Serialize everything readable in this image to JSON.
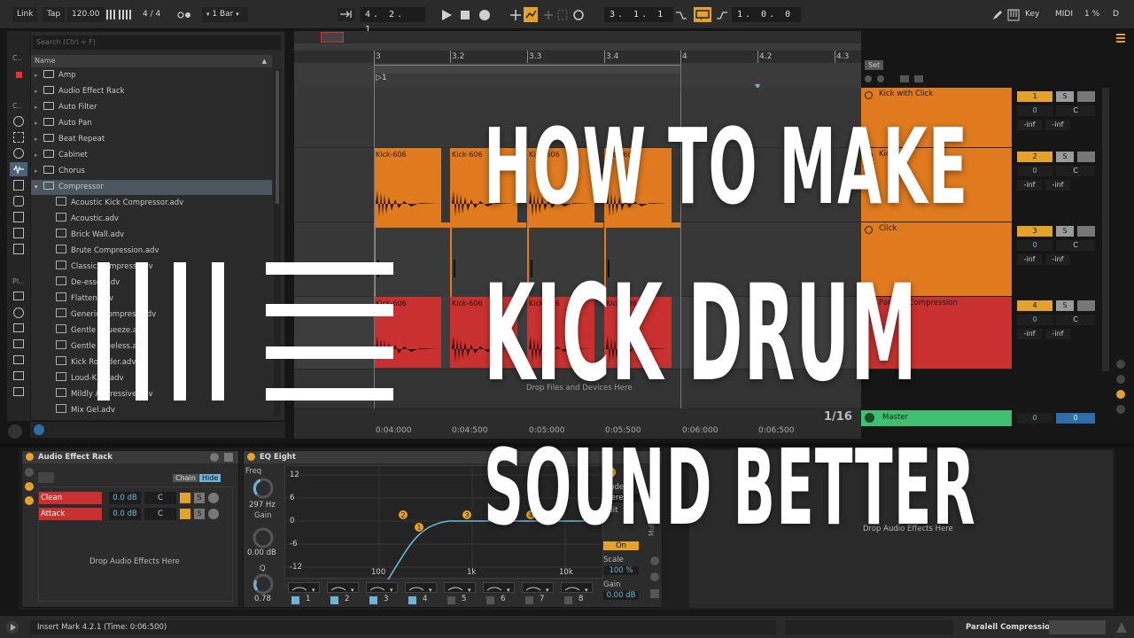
{
  "transport": {
    "link": "Link",
    "tap": "Tap",
    "tempo": "120.00",
    "signature_num": "4",
    "signature_sep": "/",
    "signature_den": "4",
    "quantize": "1 Bar",
    "position": "4. 2. 1",
    "loop_start": "3. 1. 1",
    "loop_length": "1. 0. 0",
    "key": "Key",
    "midi": "MIDI",
    "cpu": "1 %",
    "d": "D"
  },
  "browser": {
    "search_placeholder": "Search (Ctrl + F)",
    "column_name": "Name",
    "folders": [
      "Amp",
      "Audio Effect Rack",
      "Auto Filter",
      "Auto Pan",
      "Beat Repeat",
      "Cabinet",
      "Chorus"
    ],
    "selected_folder": "Compressor",
    "files": [
      "Acoustic Kick Compressor.adv",
      "Acoustic.adv",
      "Brick Wall.adv",
      "Brute Compression.adv",
      "Classic Compress.adv",
      "De-esser.adv",
      "Flatten.adv",
      "Generic Compress.adv",
      "Gentle Squeeze.adv",
      "Gentle Glueless.adv",
      "Kick Rounder.adv",
      "Loud-Kick.adv",
      "Mildly Aggressive.adv",
      "Mix Gel.adv"
    ],
    "left_labels": [
      "C..",
      "C..",
      "Pl.."
    ]
  },
  "arrangement": {
    "ruler_labels": [
      "3",
      "3.2",
      "3.3",
      "3.4",
      "4",
      "4.2",
      "4.3"
    ],
    "loop_marker": "1",
    "clip_name": "Kick-606",
    "time_labels": [
      "0:04:000",
      "0:04:500",
      "0:05:000",
      "0:05:500",
      "0:06:000",
      "0:06:500"
    ],
    "zoom": "1/16",
    "drop_hint": "Drop Files and Devices Here"
  },
  "tracks": {
    "set_label": "Set",
    "items": [
      {
        "name": "Kick with Click",
        "number": "1",
        "vol": "0",
        "pan": "C",
        "meter_a": "-inf",
        "meter_b": "-inf",
        "color": "#e07a1f"
      },
      {
        "name": "Kick",
        "number": "2",
        "vol": "0",
        "pan": "C",
        "meter_a": "-inf",
        "meter_b": "-inf",
        "color": "#e07a1f"
      },
      {
        "name": "Click",
        "number": "3",
        "vol": "0",
        "pan": "C",
        "meter_a": "-inf",
        "meter_b": "-inf",
        "color": "#e07a1f"
      },
      {
        "name": "Paralell Compression",
        "number": "4",
        "vol": "0",
        "pan": "C",
        "meter_a": "-inf",
        "meter_b": "-inf",
        "color": "#c8312f"
      }
    ],
    "master": {
      "name": "Master",
      "vol": "0",
      "pan": "0",
      "color": "#3fbf6f"
    },
    "solo": "S"
  },
  "rack": {
    "title": "Audio Effect Rack",
    "chain": "Chain",
    "hide": "Hide",
    "chains": [
      {
        "name": "Clean",
        "vol": "0.0 dB",
        "pan": "C"
      },
      {
        "name": "Attack",
        "vol": "0.0 dB",
        "pan": "C"
      }
    ],
    "solo": "S",
    "drop_hint": "Drop Audio Effects Here"
  },
  "eq": {
    "title": "EQ Eight",
    "freq_label": "Freq",
    "freq_value": "297 Hz",
    "gain_label": "Gain",
    "gain_value": "0.00 dB",
    "q_label": "Q",
    "q_value": "0.78",
    "db_ticks": [
      "12",
      "6",
      "0",
      "-6",
      "-12"
    ],
    "freq_ticks": [
      "100",
      "1k",
      "10k"
    ],
    "mode_label": "Mode",
    "mode_value": "Stere",
    "edit_label": "Edit",
    "adapt_on": "On",
    "scale_label": "Scale",
    "scale_value": "100 %",
    "out_gain_label": "Gain",
    "out_gain_value": "0.00 dB",
    "side_label": "Multiband",
    "bands": [
      "1",
      "2",
      "3",
      "4",
      "5",
      "6",
      "7",
      "8"
    ],
    "nodes": [
      "1",
      "2",
      "3",
      "4"
    ]
  },
  "right_drop": "Drop Audio Effects Here",
  "status": {
    "message": "Insert Mark 4.2.1 (Time: 0:06:500)",
    "track": "Paralell Compression"
  },
  "overlay": {
    "line1": "HOW TO MAKE",
    "line2": "KICK DRUM",
    "line3": "SOUND BETTER"
  }
}
